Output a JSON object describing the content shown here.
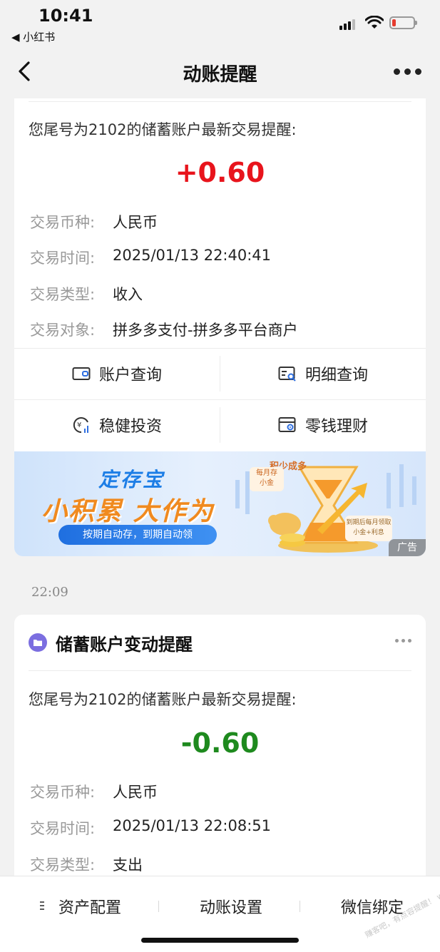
{
  "status_bar": {
    "time": "10:41",
    "back_app": "◀ 小红书"
  },
  "nav": {
    "title": "动账提醒"
  },
  "card1": {
    "intro": "您尾号为2102的储蓄账户最新交易提醒:",
    "amount": "+0.60",
    "amount_color": "#e8141c",
    "rows": [
      {
        "label": "交易币种:",
        "value": "人民币"
      },
      {
        "label": "交易时间:",
        "value": "2025/01/13 22:40:41"
      },
      {
        "label": "交易类型:",
        "value": "收入"
      },
      {
        "label": "交易对象:",
        "value": "拼多多支付-拼多多平台商户"
      }
    ],
    "actions": [
      {
        "label": "账户查询",
        "icon": "wallet-icon"
      },
      {
        "label": "明细查询",
        "icon": "statement-search-icon"
      },
      {
        "label": "稳健投资",
        "icon": "yuan-chart-icon"
      },
      {
        "label": "零钱理财",
        "icon": "wallet-target-icon"
      }
    ]
  },
  "banner": {
    "title": "定存宝",
    "headline": "小积累 大作为",
    "pill": "按期自动存，到期自动领",
    "ad_label": "广告",
    "tag_top": "积少成多",
    "tag_monthly_1": "每月存",
    "tag_monthly_2": "小金",
    "tag_due_1": "到期后每月领取",
    "tag_due_2": "小金+利息"
  },
  "timestamp": "22:09",
  "card2": {
    "title": "储蓄账户变动提醒",
    "intro": "您尾号为2102的储蓄账户最新交易提醒:",
    "amount": "-0.60",
    "amount_color": "#1e8a1e",
    "rows": [
      {
        "label": "交易币种:",
        "value": "人民币"
      },
      {
        "label": "交易时间:",
        "value": "2025/01/13 22:08:51"
      },
      {
        "label": "交易类型:",
        "value": "支出"
      }
    ]
  },
  "bottom_tabs": [
    {
      "label": "资产配置"
    },
    {
      "label": "动账设置"
    },
    {
      "label": "微信绑定"
    }
  ],
  "watermark": "赚客吧，有点容提醒！ www.zuanke8.com"
}
